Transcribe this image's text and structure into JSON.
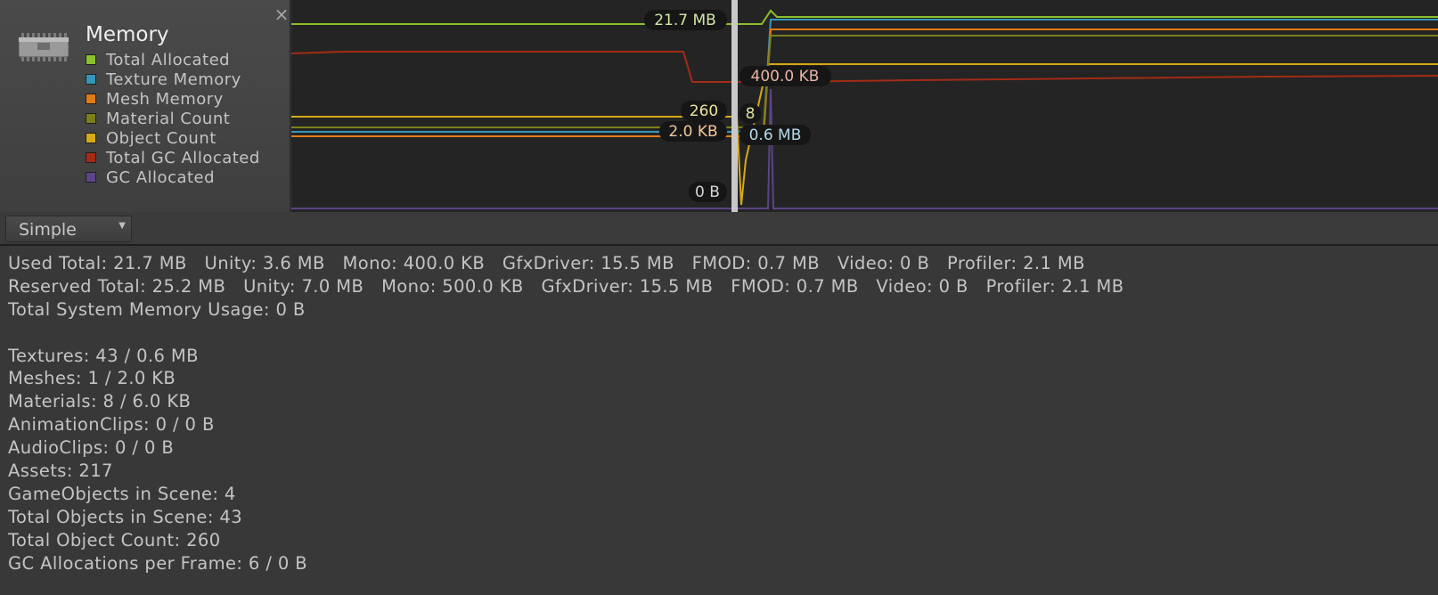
{
  "legend": {
    "title": "Memory",
    "items": [
      {
        "label": "Total Allocated",
        "color": "#8bbf2c"
      },
      {
        "label": "Texture Memory",
        "color": "#3795b8"
      },
      {
        "label": "Mesh Memory",
        "color": "#e07b18"
      },
      {
        "label": "Material Count",
        "color": "#7d7f1d"
      },
      {
        "label": "Object Count",
        "color": "#d6aa16"
      },
      {
        "label": "Total GC Allocated",
        "color": "#a42b16"
      },
      {
        "label": "GC Allocated",
        "color": "#5c4486"
      }
    ]
  },
  "graph_labels": {
    "total_allocated": "21.7 MB",
    "total_gc": "400.0 KB",
    "object_count": "260",
    "material_count": "8",
    "mesh_memory": "2.0 KB",
    "texture_memory": "0.6 MB",
    "gc_allocated": "0 B"
  },
  "toolbar": {
    "mode": "Simple"
  },
  "stats": {
    "line1": "Used Total: 21.7 MB   Unity: 3.6 MB   Mono: 400.0 KB   GfxDriver: 15.5 MB   FMOD: 0.7 MB   Video: 0 B   Profiler: 2.1 MB",
    "line2": "Reserved Total: 25.2 MB   Unity: 7.0 MB   Mono: 500.0 KB   GfxDriver: 15.5 MB   FMOD: 0.7 MB   Video: 0 B   Profiler: 2.1 MB",
    "line3": "Total System Memory Usage: 0 B",
    "details": [
      "Textures: 43 / 0.6 MB",
      "Meshes: 1 / 2.0 KB",
      "Materials: 8 / 6.0 KB",
      "AnimationClips: 0 / 0 B",
      "AudioClips: 0 / 0 B",
      "Assets: 217",
      "GameObjects in Scene: 4",
      "Total Objects in Scene: 43",
      "Total Object Count: 260",
      "GC Allocations per Frame: 6 / 0 B"
    ]
  },
  "icons": {
    "close": "close-icon",
    "module": "memory-chip-icon",
    "dropdown": "dropdown-arrow-icon"
  }
}
